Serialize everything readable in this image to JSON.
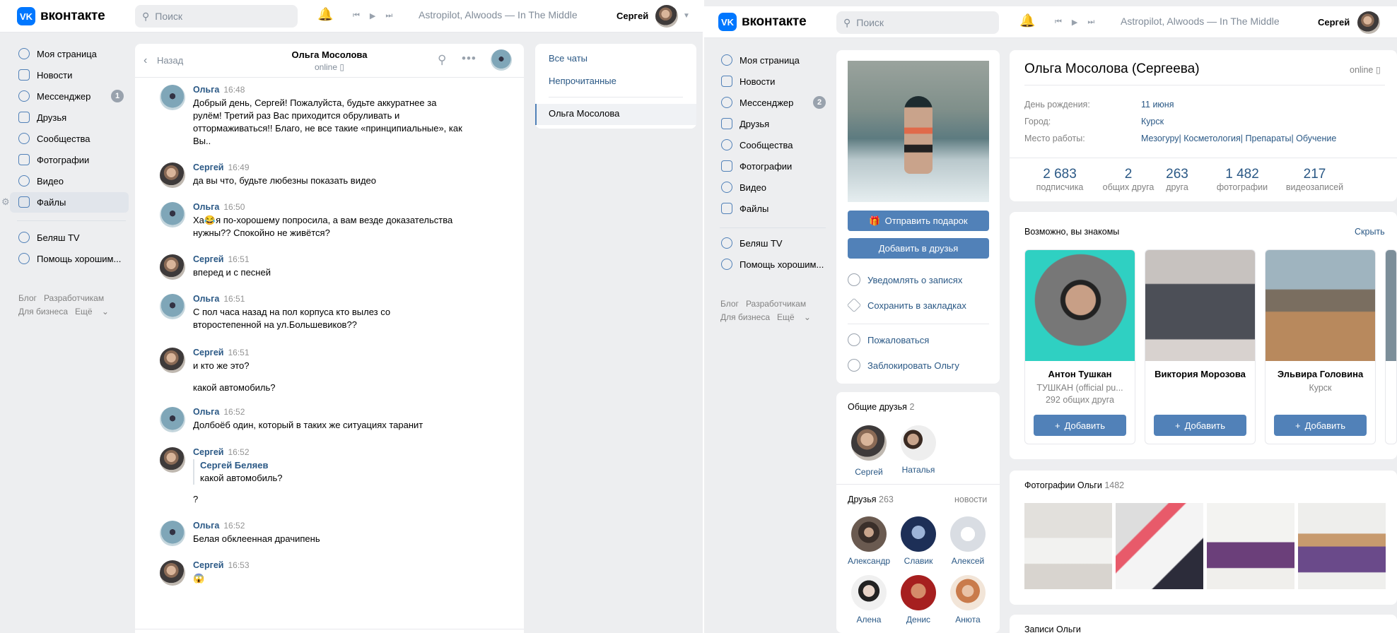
{
  "brand": {
    "name": "вконтакте",
    "logo": "VK"
  },
  "left_window": {
    "search_placeholder": "Поиск",
    "now_playing": "Astropilot, Alwoods — In The Middle",
    "user_name": "Сергей",
    "nav": [
      {
        "label": "Моя страница",
        "icon": "user-icon"
      },
      {
        "label": "Новости",
        "icon": "news-icon"
      },
      {
        "label": "Мессенджер",
        "icon": "chat-icon",
        "badge": "1"
      },
      {
        "label": "Друзья",
        "icon": "friends-icon"
      },
      {
        "label": "Сообщества",
        "icon": "groups-icon"
      },
      {
        "label": "Фотографии",
        "icon": "photo-icon"
      },
      {
        "label": "Видео",
        "icon": "video-icon"
      },
      {
        "label": "Файлы",
        "icon": "file-icon"
      }
    ],
    "nav_extra": [
      {
        "label": "Беляш TV",
        "icon": "groups-icon"
      },
      {
        "label": "Помощь хорошим...",
        "icon": "groups-icon"
      }
    ],
    "footer": {
      "blog": "Блог",
      "devs": "Разработчикам",
      "business": "Для бизнеса",
      "more": "Ещё"
    },
    "chat": {
      "back": "Назад",
      "title": "Ольга Мосолова",
      "status": "online",
      "messages": [
        {
          "name": "Ольга",
          "time": "16:48",
          "lines": [
            "Добрый день, Сергей! Пожалуйста, будьте аккуратнее за",
            "рулём! Третий раз Вас приходится обруливать и",
            "оттормаживаться!! Благо, не все такие «принципиальные», как",
            "Вы.."
          ]
        },
        {
          "name": "Сергей",
          "time": "16:49",
          "lines": [
            "да вы что, будьте любезны показать видео"
          ]
        },
        {
          "name": "Ольга",
          "time": "16:50",
          "lines": [
            "Ха😂я по-хорошему попросила, а вам везде доказательства",
            "нужны?? Спокойно не живётся?"
          ]
        },
        {
          "name": "Сергей",
          "time": "16:51",
          "lines": [
            "вперед и с песней"
          ]
        },
        {
          "name": "Ольга",
          "time": "16:51",
          "lines": [
            "С пол часа назад на пол корпуса кто вылез со",
            "второстепенной на ул.Большевиков??"
          ]
        },
        {
          "name": "Сергей",
          "time": "16:51",
          "lines": [
            "и кто же это?"
          ],
          "extra": "какой автомобиль?"
        },
        {
          "name": "Ольга",
          "time": "16:52",
          "lines": [
            "Долбоёб один, который в таких же ситуациях таранит"
          ]
        },
        {
          "name": "Сергей",
          "time": "16:52",
          "quote_name": "Сергей Беляев",
          "quote_text": "какой автомобиль?",
          "lines": [
            "?"
          ]
        },
        {
          "name": "Ольга",
          "time": "16:52",
          "lines": [
            "Белая обклеенная драчипень"
          ]
        },
        {
          "name": "Сергей",
          "time": "16:53",
          "lines": [
            "😱"
          ]
        }
      ]
    },
    "filters": {
      "all": "Все чаты",
      "unread": "Непрочитанные",
      "selected": "Ольга Мосолова"
    }
  },
  "right_window": {
    "search_placeholder": "Поиск",
    "now_playing": "Astropilot, Alwoods — In The Middle",
    "user_name": "Сергей",
    "nav": [
      {
        "label": "Моя страница"
      },
      {
        "label": "Новости"
      },
      {
        "label": "Мессенджер",
        "badge": "2"
      },
      {
        "label": "Друзья"
      },
      {
        "label": "Сообщества"
      },
      {
        "label": "Фотографии"
      },
      {
        "label": "Видео"
      },
      {
        "label": "Файлы"
      }
    ],
    "nav_extra": [
      {
        "label": "Беляш TV"
      },
      {
        "label": "Помощь хорошим..."
      }
    ],
    "footer": {
      "blog": "Блог",
      "devs": "Разработчикам",
      "business": "Для бизнеса",
      "more": "Ещё"
    },
    "profile": {
      "name": "Ольга Мосолова (Сергеева)",
      "status": "online",
      "gift_button": "Отправить подарок",
      "add_button": "Добавить в друзья",
      "actions": [
        "Уведомлять о записях",
        "Сохранить в закладках",
        "Пожаловаться",
        "Заблокировать Ольгу"
      ],
      "info": [
        {
          "label": "День рождения:",
          "value": "11 июня"
        },
        {
          "label": "Город:",
          "value": "Курск"
        },
        {
          "label": "Место работы:",
          "value": "Мезогуру| Косметология| Препараты| Обучение"
        }
      ],
      "counters": [
        {
          "num": "2 683",
          "label": "подписчика"
        },
        {
          "num": "2",
          "label": "общих друга"
        },
        {
          "num": "263",
          "label": "друга"
        },
        {
          "num": "1 482",
          "label": "фотографии"
        },
        {
          "num": "217",
          "label": "видеозаписей"
        }
      ],
      "suggestions_title": "Возможно, вы знакомы",
      "hide": "Скрыть",
      "suggestions": [
        {
          "name": "Антон Тушкан",
          "sub1": "ТУШКАН (official pu...",
          "sub2": "292 общих друга"
        },
        {
          "name": "Виктория Морозова",
          "sub1": "",
          "sub2": ""
        },
        {
          "name": "Эльвира Головина",
          "sub1": "Курск",
          "sub2": ""
        }
      ],
      "add_label": "Добавить",
      "mutual_title": "Общие друзья",
      "mutual_count": "2",
      "mutual": [
        "Сергей",
        "Наталья"
      ],
      "friends_title": "Друзья",
      "friends_count": "263",
      "friends_news": "новости",
      "friends": [
        "Александр",
        "Славик",
        "Алексей",
        "Алена",
        "Денис",
        "Анюта"
      ],
      "photos_title": "Фотографии Ольги",
      "photos_count": "1482",
      "posts_title": "Записи Ольги"
    }
  }
}
